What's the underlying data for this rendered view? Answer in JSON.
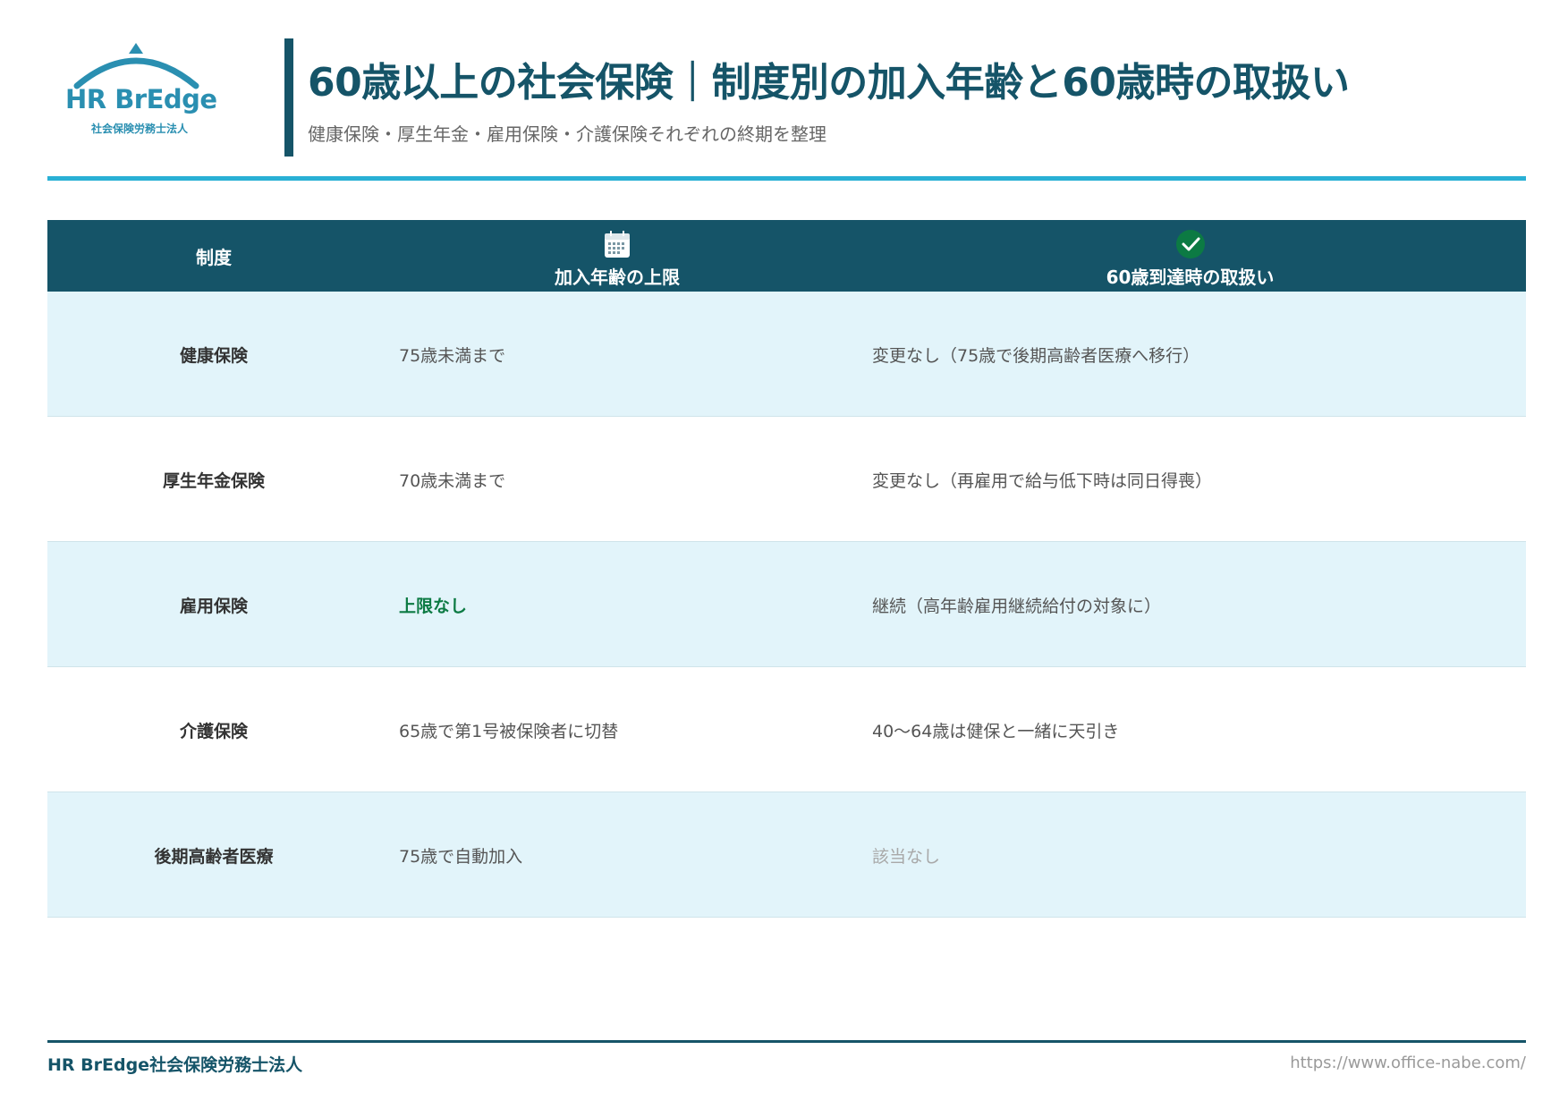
{
  "logo": {
    "name": "HR BrEdge",
    "sub": "社会保険労務士法人"
  },
  "header": {
    "title": "60歳以上の社会保険｜制度別の加入年齢と60歳時の取扱い",
    "subtitle": "健康保険・厚生年金・雇用保険・介護保険それぞれの終期を整理"
  },
  "table": {
    "headers": [
      {
        "label": "制度",
        "icon": ""
      },
      {
        "label": "加入年齢の上限",
        "icon": "calendar-icon"
      },
      {
        "label": "60歳到達時の取扱い",
        "icon": "check-circle-icon"
      }
    ],
    "rows": [
      {
        "system": "健康保険",
        "limit": "75歳未満まで",
        "at60": "変更なし（75歳で後期高齢者医療へ移行）"
      },
      {
        "system": "厚生年金保険",
        "limit": "70歳未満まで",
        "at60": "変更なし（再雇用で給与低下時は同日得喪）"
      },
      {
        "system": "雇用保険",
        "limit": "上限なし",
        "at60": "継続（高年齢雇用継続給付の対象に）"
      },
      {
        "system": "介護保険",
        "limit": "65歳で第1号被保険者に切替",
        "at60": "40〜64歳は健保と一緒に天引き"
      },
      {
        "system": "後期高齢者医療",
        "limit": "75歳で自動加入",
        "at60": "該当なし"
      }
    ]
  },
  "footer": {
    "left": "HR BrEdge社会保険労務士法人",
    "right": "https://www.office-nabe.com/"
  },
  "colors": {
    "primary": "#155468",
    "accent": "#29b0d5",
    "row_alt": "#e2f4fa",
    "emphasis_green": "#0c7a43",
    "logo_blue": "#2a8fb1"
  }
}
